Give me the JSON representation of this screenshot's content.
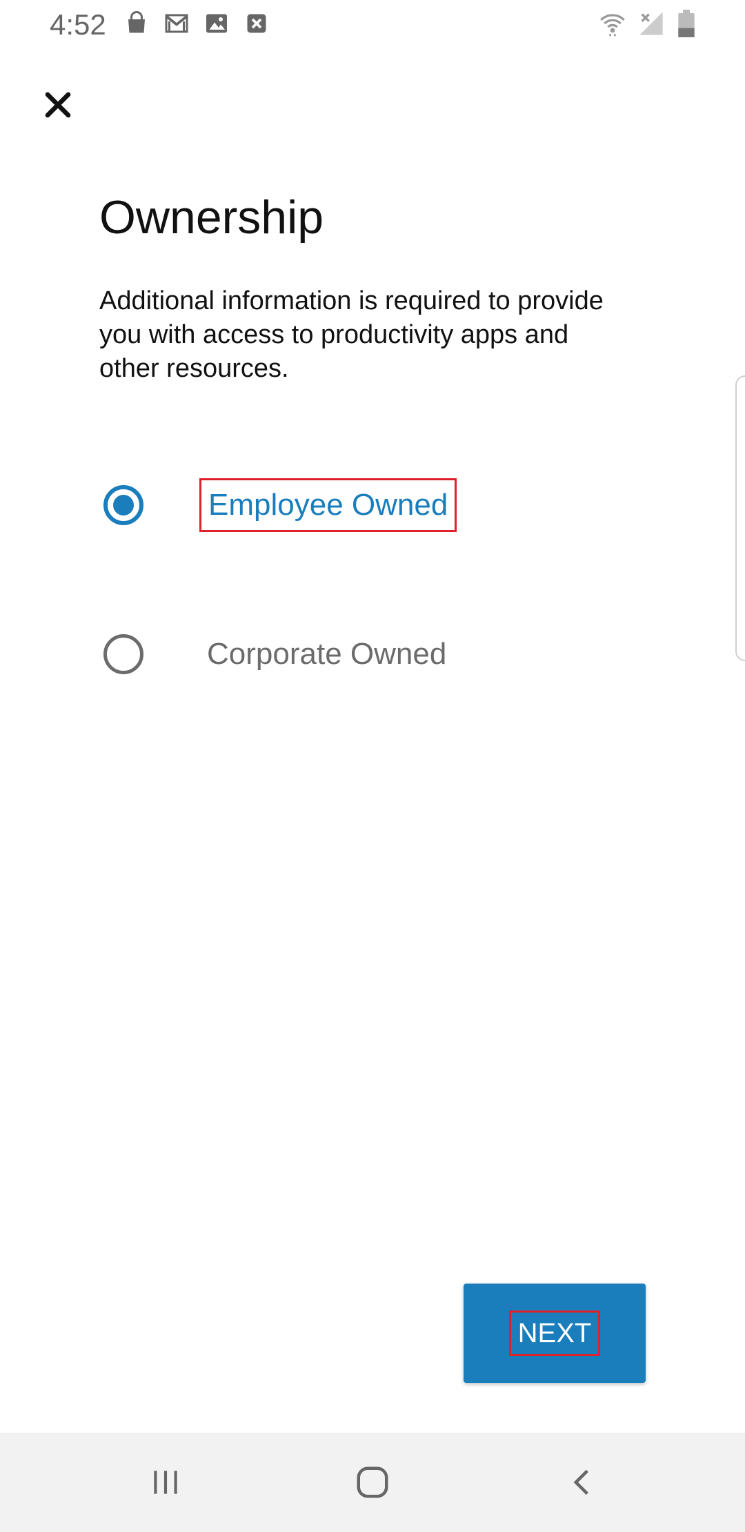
{
  "status_bar": {
    "time": "4:52",
    "left_icons": [
      "shopping-bag-icon",
      "gmail-icon",
      "image-icon",
      "close-box-icon"
    ],
    "right_icons": [
      "wifi-icon",
      "signal-icon",
      "battery-icon"
    ]
  },
  "header": {
    "close_icon": "close-icon"
  },
  "main": {
    "title": "Ownership",
    "description": "Additional information is required to provide you with access to productivity apps and other resources.",
    "options": [
      {
        "label": "Employee Owned",
        "selected": true
      },
      {
        "label": "Corporate Owned",
        "selected": false
      }
    ],
    "next_label": "NEXT"
  },
  "nav_bar": {
    "items": [
      "recent-apps-icon",
      "home-icon",
      "back-icon"
    ]
  },
  "colors": {
    "accent": "#1a7dbc",
    "highlight": "#e0202a",
    "unselected": "#6b6b6b"
  }
}
